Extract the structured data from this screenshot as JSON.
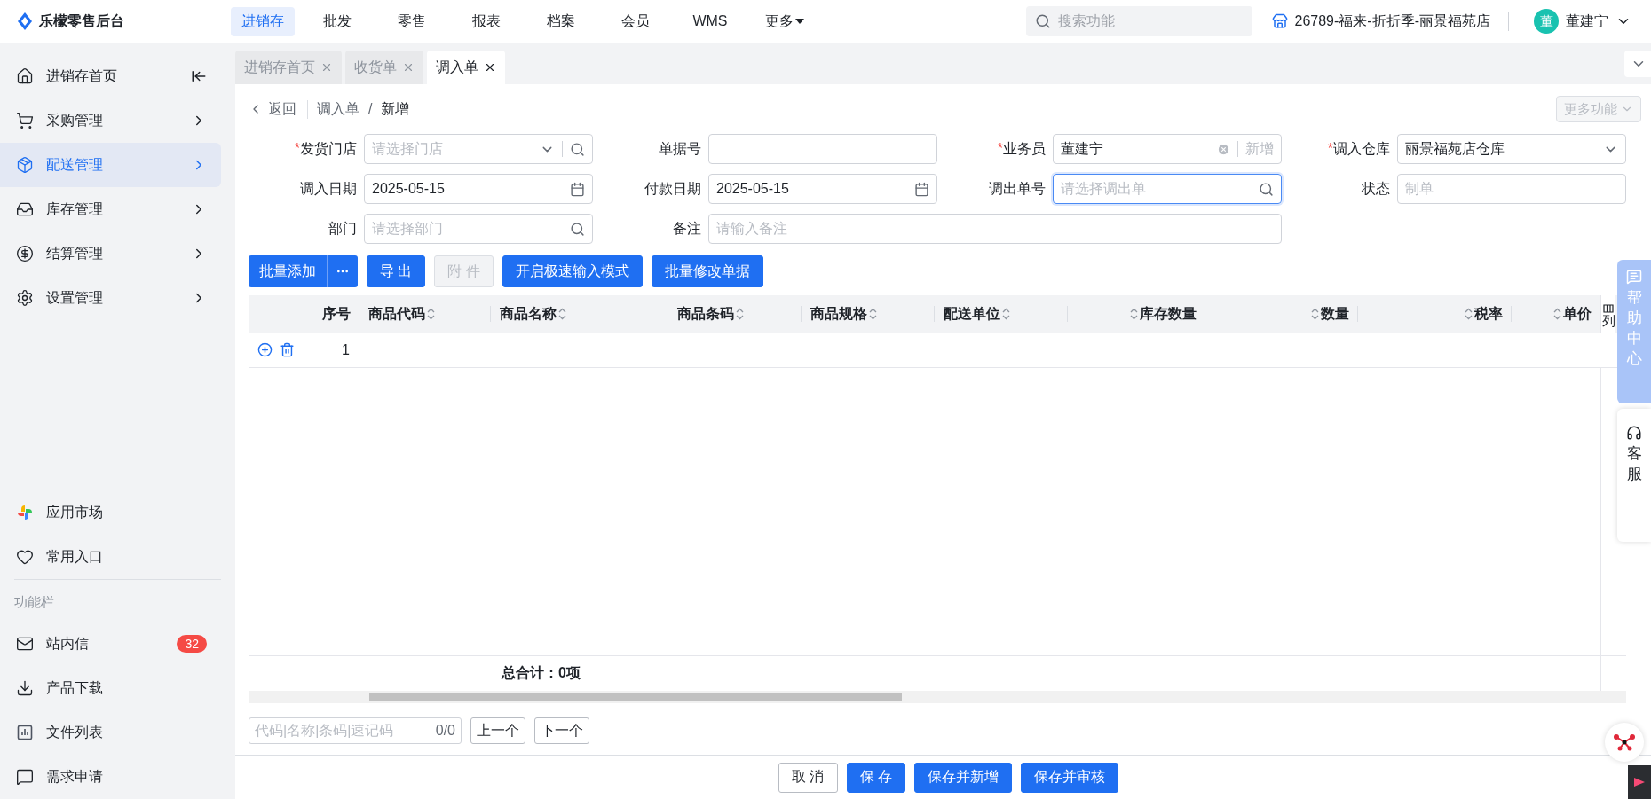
{
  "app": {
    "title": "乐檬零售后台"
  },
  "top_nav": [
    {
      "label": "进销存",
      "selected": true
    },
    {
      "label": "批发",
      "selected": false
    },
    {
      "label": "零售",
      "selected": false
    },
    {
      "label": "报表",
      "selected": false
    },
    {
      "label": "档案",
      "selected": false
    },
    {
      "label": "会员",
      "selected": false
    },
    {
      "label": "WMS",
      "selected": false
    },
    {
      "label": "更多",
      "selected": false,
      "has_menu": true
    }
  ],
  "search": {
    "placeholder": "搜索功能"
  },
  "store": {
    "name": "26789-福来-折折季-丽景福苑店"
  },
  "user": {
    "avatar_text": "董",
    "name": "董建宁"
  },
  "sidebar": {
    "items": [
      {
        "kind": "home",
        "label": "进销存首页",
        "selected": false
      },
      {
        "kind": "cart",
        "label": "采购管理",
        "selected": false
      },
      {
        "kind": "box",
        "label": "配送管理",
        "selected": true
      },
      {
        "kind": "stock",
        "label": "库存管理",
        "selected": false
      },
      {
        "kind": "money",
        "label": "结算管理",
        "selected": false
      },
      {
        "kind": "settings",
        "label": "设置管理",
        "selected": false
      }
    ],
    "bottom_items": [
      {
        "kind": "apps",
        "label": "应用市场"
      },
      {
        "kind": "heart",
        "label": "常用入口"
      }
    ],
    "section_title": "功能栏",
    "tool_items": [
      {
        "kind": "mail",
        "label": "站内信",
        "badge": "32"
      },
      {
        "kind": "download",
        "label": "产品下载"
      },
      {
        "kind": "chart",
        "label": "文件列表"
      },
      {
        "kind": "message",
        "label": "需求申请"
      }
    ]
  },
  "tabs": [
    {
      "label": "进销存首页",
      "selected": false
    },
    {
      "label": "收货单",
      "selected": false
    },
    {
      "label": "调入单",
      "selected": true
    }
  ],
  "breadcrumb": {
    "back": "返回",
    "items": [
      "调入单",
      "新增"
    ],
    "separator": "/",
    "more_button": "更多功能",
    "more_disabled": true
  },
  "required_mark": "*",
  "form_rows": [
    [
      {
        "label": "发货门店",
        "required": true,
        "kind": "select-search",
        "placeholder": "请选择门店",
        "focused": false
      },
      {
        "label": "单据号",
        "required": false,
        "kind": "input",
        "focused": false
      },
      {
        "label": "业务员",
        "required": true,
        "kind": "clearable",
        "value": "董建宁",
        "action": "新增",
        "focused": false
      },
      {
        "label": "调入仓库",
        "required": true,
        "kind": "select",
        "value": "丽景福苑店仓库",
        "focused": false
      }
    ],
    [
      {
        "label": "调入日期",
        "required": false,
        "kind": "date",
        "value": "2025-05-15",
        "focused": false
      },
      {
        "label": "付款日期",
        "required": false,
        "kind": "date",
        "value": "2025-05-15",
        "focused": false
      },
      {
        "label": "调出单号",
        "required": false,
        "kind": "search",
        "placeholder": "请选择调出单",
        "focused": true
      },
      {
        "label": "状态",
        "required": false,
        "kind": "input",
        "placeholder": "制单",
        "focused": false
      }
    ],
    [
      {
        "label": "部门",
        "required": false,
        "kind": "search",
        "placeholder": "请选择部门",
        "focused": false
      },
      {
        "label": "备注",
        "required": false,
        "kind": "wide",
        "placeholder": "请输入备注",
        "focused": false
      }
    ]
  ],
  "actions": [
    {
      "label": "批量添加",
      "kind": "split",
      "disabled": false
    },
    {
      "label": "导 出",
      "kind": "plain",
      "disabled": false
    },
    {
      "label": "附 件",
      "kind": "plain",
      "disabled": true
    },
    {
      "label": "开启极速输入模式",
      "kind": "plain",
      "disabled": false
    },
    {
      "label": "批量修改单据",
      "kind": "plain",
      "disabled": false
    }
  ],
  "table": {
    "columns": [
      {
        "label": "序号",
        "kind": "index"
      },
      {
        "label": "商品代码",
        "kind": "text"
      },
      {
        "label": "商品名称",
        "kind": "text"
      },
      {
        "label": "商品条码",
        "kind": "text"
      },
      {
        "label": "商品规格",
        "kind": "text"
      },
      {
        "label": "配送单位",
        "kind": "text"
      },
      {
        "label": "库存数量",
        "kind": "number"
      },
      {
        "label": "数量",
        "kind": "number"
      },
      {
        "label": "税率",
        "kind": "number"
      },
      {
        "label": "单价",
        "kind": "number"
      }
    ],
    "settings_label": "列",
    "rows": [
      {
        "index": "1"
      }
    ],
    "total": "总合计：0项"
  },
  "finder": {
    "placeholder": "代码|名称|条码|速记码",
    "count": "0/0",
    "prev": "上一个",
    "next": "下一个"
  },
  "footer_buttons": [
    {
      "label": "取 消",
      "kind": "secondary"
    },
    {
      "label": "保 存",
      "kind": "primary"
    },
    {
      "label": "保存并新增",
      "kind": "primary"
    },
    {
      "label": "保存并审核",
      "kind": "primary"
    }
  ],
  "float_tabs": [
    {
      "label": "帮助中心",
      "kind": "help"
    },
    {
      "label": "客服",
      "kind": "service"
    }
  ]
}
